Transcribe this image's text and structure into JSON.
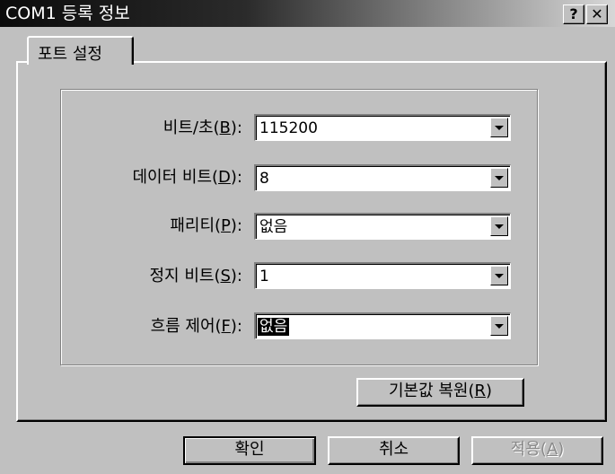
{
  "window": {
    "title": "COM1 등록 정보",
    "help_glyph": "?",
    "close_glyph": "✕"
  },
  "tabs": [
    {
      "label": "포트 설정",
      "selected": true
    }
  ],
  "fields": {
    "bits_per_second": {
      "label_prefix": "비트/초(",
      "mnemonic": "B",
      "label_suffix": "):",
      "value": "115200"
    },
    "data_bits": {
      "label_prefix": "데이터 비트(",
      "mnemonic": "D",
      "label_suffix": "):",
      "value": "8"
    },
    "parity": {
      "label_prefix": "패리티(",
      "mnemonic": "P",
      "label_suffix": "):",
      "value": "없음"
    },
    "stop_bits": {
      "label_prefix": "정지 비트(",
      "mnemonic": "S",
      "label_suffix": "):",
      "value": "1"
    },
    "flow_control": {
      "label_prefix": "흐름 제어(",
      "mnemonic": "F",
      "label_suffix": "):",
      "value": "없음"
    }
  },
  "buttons": {
    "restore_defaults": {
      "prefix": "기본값 복원(",
      "mnemonic": "R",
      "suffix": ")"
    },
    "ok": {
      "label": "확인"
    },
    "cancel": {
      "label": "취소"
    },
    "apply": {
      "prefix": "적용(",
      "mnemonic": "A",
      "suffix": ")",
      "enabled": false
    }
  },
  "colors": {
    "face": "#c0c0c0",
    "title_start": "#0b0b0b",
    "title_end": "#d7d7d7",
    "selection": "#000000"
  }
}
